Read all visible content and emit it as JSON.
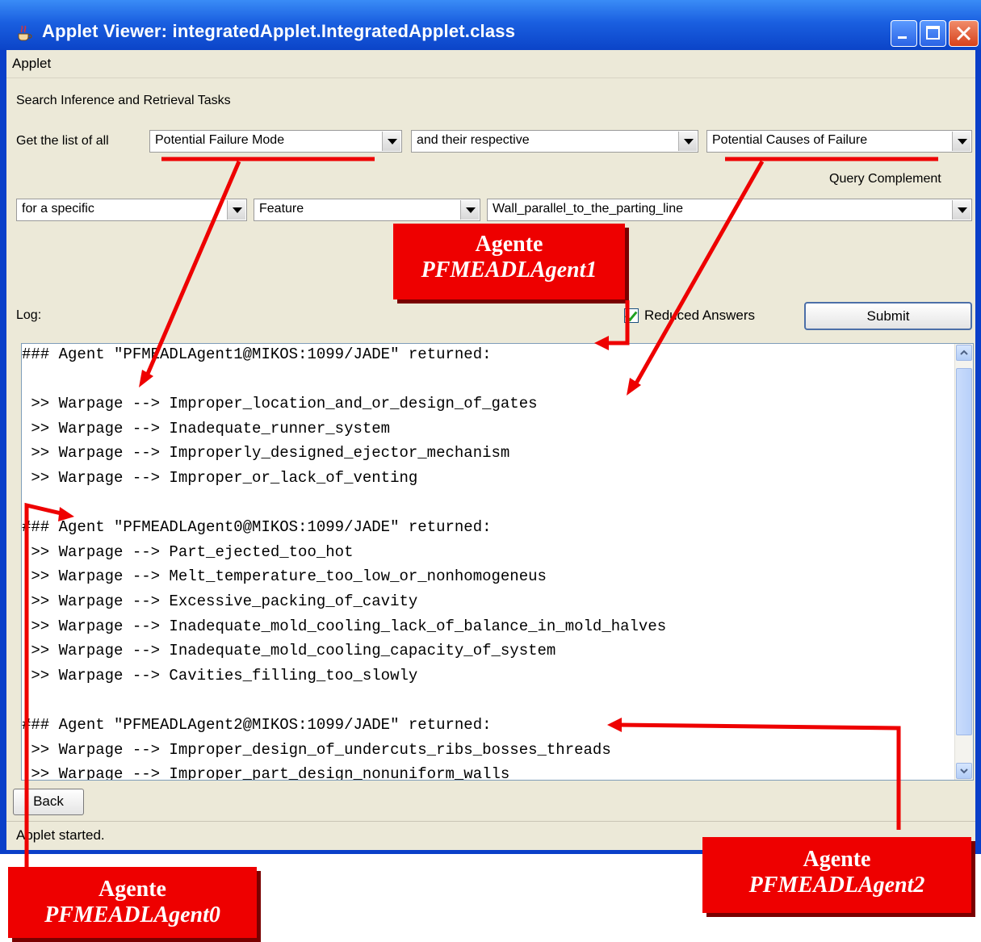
{
  "window": {
    "title": "Applet Viewer: integratedApplet.IntegratedApplet.class"
  },
  "menubar": {
    "applet_menu": "Applet"
  },
  "form": {
    "section_title": "Search Inference and Retrieval Tasks",
    "get_list_label": "Get the list of all",
    "combo_failure_mode": "Potential Failure Mode",
    "combo_respective": "and their respective",
    "combo_causes": "Potential Causes of Failure",
    "query_complement_label": "Query Complement",
    "combo_specific": "for a specific",
    "combo_feature": "Feature",
    "combo_feature_value": "Wall_parallel_to_the_parting_line",
    "log_label": "Log:",
    "reduced_answers_label": "Reduced Answers",
    "reduced_answers_checked": true,
    "submit_label": "Submit",
    "back_label": "Back"
  },
  "log": {
    "lines": [
      "### Agent \"PFMEADLAgent1@MIKOS:1099/JADE\" returned:",
      "",
      " >> Warpage --> Improper_location_and_or_design_of_gates",
      " >> Warpage --> Inadequate_runner_system",
      " >> Warpage --> Improperly_designed_ejector_mechanism",
      " >> Warpage --> Improper_or_lack_of_venting",
      "",
      "### Agent \"PFMEADLAgent0@MIKOS:1099/JADE\" returned:",
      " >> Warpage --> Part_ejected_too_hot",
      " >> Warpage --> Melt_temperature_too_low_or_nonhomogeneus",
      " >> Warpage --> Excessive_packing_of_cavity",
      " >> Warpage --> Inadequate_mold_cooling_lack_of_balance_in_mold_halves",
      " >> Warpage --> Inadequate_mold_cooling_capacity_of_system",
      " >> Warpage --> Cavities_filling_too_slowly",
      "",
      "### Agent \"PFMEADLAgent2@MIKOS:1099/JADE\" returned:",
      " >> Warpage --> Improper_design_of_undercuts_ribs_bosses_threads",
      " >> Warpage --> Improper_part_design_nonuniform_walls"
    ]
  },
  "status": {
    "text": "Applet started."
  },
  "callouts": {
    "agent1": {
      "word": "Agente",
      "name": "PFMEADLAgent1"
    },
    "agent0": {
      "word": "Agente",
      "name": "PFMEADLAgent0"
    },
    "agent2": {
      "word": "Agente",
      "name": "PFMEADLAgent2"
    }
  },
  "colors": {
    "annotation_red": "#ee0000",
    "title_blue": "#0b44c8",
    "panel_bg": "#ece9d8"
  }
}
